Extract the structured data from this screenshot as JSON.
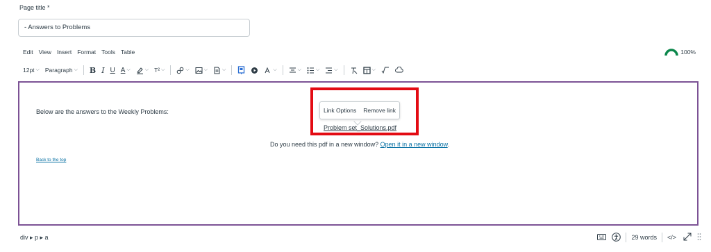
{
  "page_title_label": "Page title *",
  "page_title_value": "- Answers to Problems",
  "menubar": [
    "Edit",
    "View",
    "Insert",
    "Format",
    "Tools",
    "Table"
  ],
  "accessibility_score": "100%",
  "toolbar": {
    "font_size": "12pt",
    "block_format": "Paragraph",
    "bold": "B",
    "italic": "I",
    "underline": "U",
    "text_color": "A",
    "superscript": "T²"
  },
  "content": {
    "intro": "Below are the answers to the Weekly Problems:",
    "popup_link_options": "Link Options",
    "popup_remove_link": "Remove link",
    "pdf_link": "Problem set_Solutions.pdf",
    "question_prefix": "Do you need this pdf in a new window?",
    "question_link": "Open it in a new window",
    "question_suffix": ".",
    "back_to_top": "Back to the top"
  },
  "statusbar": {
    "path": "div ▸ p ▸ a",
    "word_count": "29 words",
    "html_toggle": "</>"
  },
  "colors": {
    "editor_border": "#7c5295",
    "highlight_box": "#e30b13",
    "link": "#0770a3",
    "score_arc": "#0b874b"
  }
}
